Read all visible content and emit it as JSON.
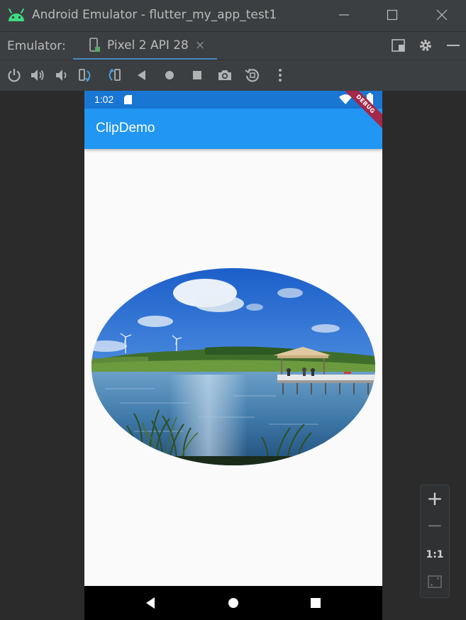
{
  "window": {
    "title": "Android Emulator - flutter_my_app_test1"
  },
  "tabstrip": {
    "label": "Emulator:",
    "device_tab": "Pixel 2 API 28",
    "close_glyph": "×"
  },
  "toolbar": {
    "buttons": [
      "power-icon",
      "volume-up-icon",
      "volume-down-icon",
      "rotate-left-icon",
      "rotate-right-icon",
      "back-icon",
      "home-icon",
      "overview-icon",
      "screenshot-icon",
      "snapshot-icon",
      "more-icon"
    ]
  },
  "device": {
    "status_time": "1:02",
    "app_title": "ClipDemo",
    "debug_banner": "DEBUG",
    "colors": {
      "status_bar": "#1976d2",
      "app_bar": "#2196f3",
      "background": "#fafafa",
      "debug_banner": "#a3284a"
    }
  },
  "zoom": {
    "plus": "+",
    "minus": "−",
    "actual_size": "1:1"
  }
}
